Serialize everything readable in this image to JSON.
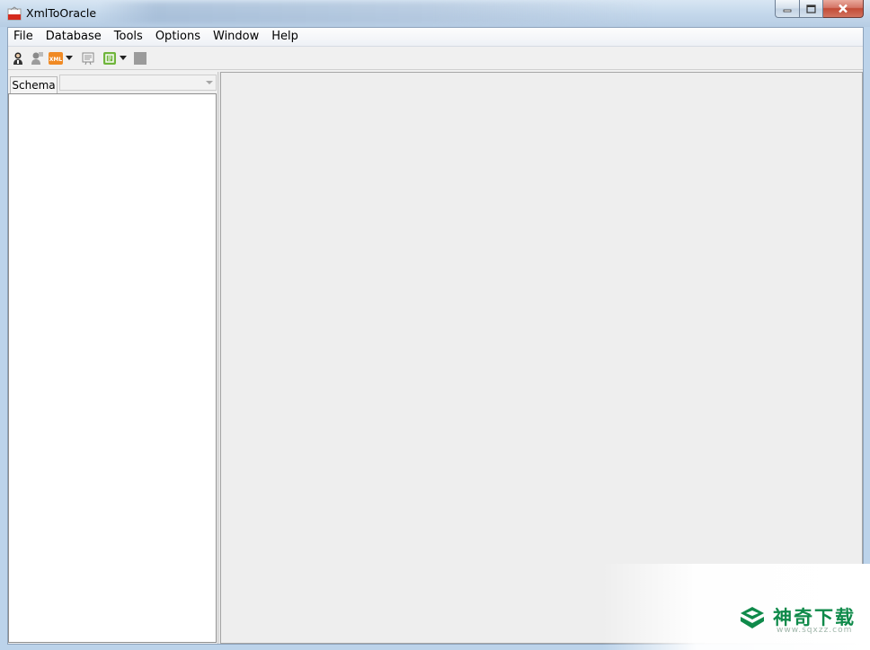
{
  "window": {
    "title": "XmlToOracle",
    "controls": {
      "minimize_icon": "minimize-icon",
      "maximize_icon": "maximize-icon",
      "close_icon": "close-icon"
    }
  },
  "menubar": {
    "items": [
      {
        "label": "File"
      },
      {
        "label": "Database"
      },
      {
        "label": "Tools"
      },
      {
        "label": "Options"
      },
      {
        "label": "Window"
      },
      {
        "label": "Help"
      }
    ]
  },
  "toolbar": {
    "buttons": [
      {
        "icon": "connect-user-icon"
      },
      {
        "icon": "disconnect-user-icon"
      },
      {
        "icon": "xml-icon",
        "text": "XML",
        "has_dropdown": true
      },
      {
        "icon": "document-icon"
      },
      {
        "icon": "export-icon",
        "has_dropdown": true
      },
      {
        "icon": "stop-icon"
      }
    ]
  },
  "left_panel": {
    "schema_label": "Schema",
    "schema_value": ""
  },
  "watermark": {
    "text": "神奇下载",
    "url": "www.sqxzz.com",
    "color": "#0f8a4a"
  }
}
